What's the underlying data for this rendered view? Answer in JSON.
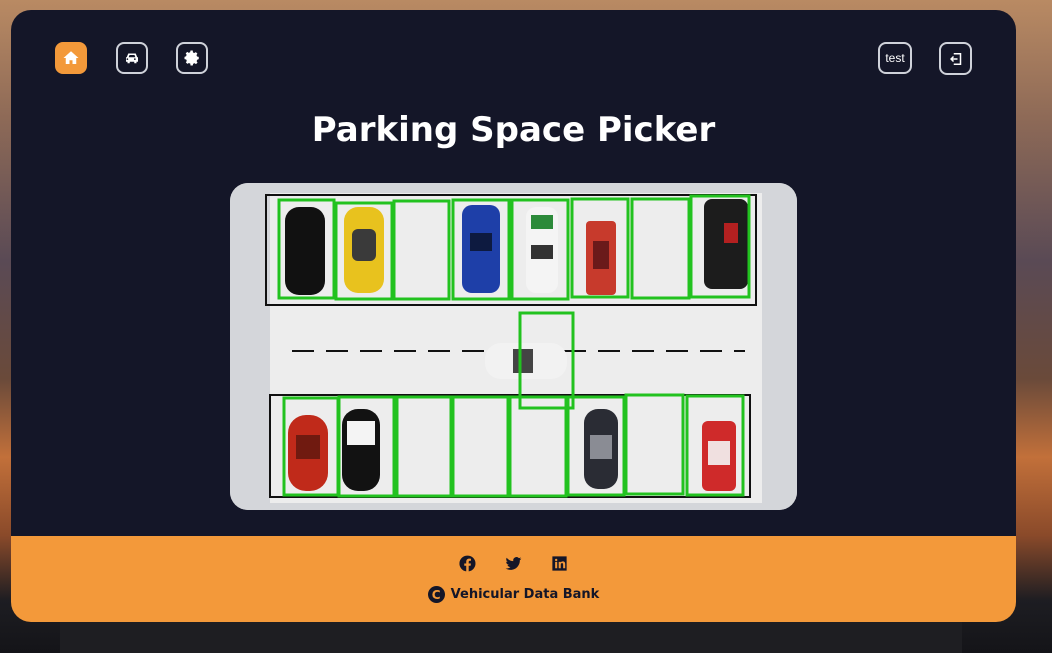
{
  "nav": {
    "home_icon": "home-icon",
    "car_icon": "car-icon",
    "settings_icon": "gear-icon",
    "user_label": "test",
    "logout_icon": "logout-icon"
  },
  "page": {
    "title": "Parking Space Picker"
  },
  "parking_lot": {
    "top_row": [
      "occupied",
      "occupied",
      "empty",
      "occupied",
      "occupied",
      "occupied",
      "empty",
      "occupied"
    ],
    "bottom_row": [
      "occupied",
      "occupied",
      "empty",
      "empty",
      "empty",
      "occupied",
      "empty",
      "occupied"
    ],
    "moving_car": "present"
  },
  "footer": {
    "social": [
      "facebook-icon",
      "twitter-icon",
      "linkedin-icon"
    ],
    "copyright_symbol": "C",
    "brand": "Vehicular Data Bank"
  },
  "colors": {
    "accent": "#f3993a",
    "card": "#141628",
    "box": "#22c21f"
  }
}
